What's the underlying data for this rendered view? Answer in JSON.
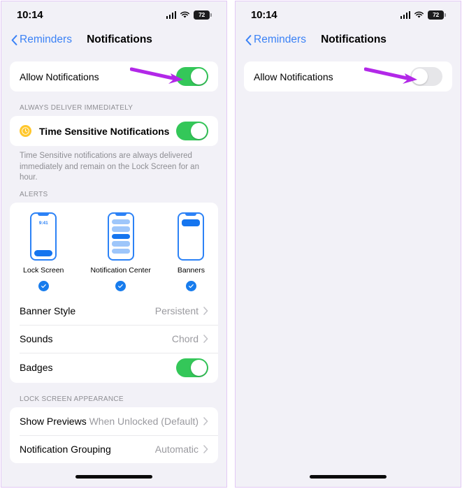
{
  "colors": {
    "accent_blue": "#3b82f6",
    "toggle_on_green": "#34c759",
    "toggle_off_gray": "#e6e6e9",
    "arrow_purple": "#b228e8",
    "alert_blue": "#1575ef",
    "check_blue": "#177ced",
    "page_bg": "#f2f1f7",
    "panel_border": "#e3c9f5",
    "time_sensitive_yellow": "#ffc72c"
  },
  "panels": [
    {
      "id": "left-panel-notifications-enabled",
      "status_bar": {
        "time": "10:14",
        "cellular_icon": "cellular-bars-icon",
        "wifi_icon": "wifi-icon",
        "battery_level": "72"
      },
      "nav": {
        "back_icon": "chevron-left-icon",
        "back_label": "Reminders",
        "title": "Notifications"
      },
      "allow_row": {
        "label": "Allow Notifications",
        "toggle_state": "on"
      },
      "annotation_arrow": {
        "icon": "arrow-right-annotation",
        "points_to": "allow-notifications-toggle"
      },
      "always_deliver": {
        "header": "ALWAYS DELIVER IMMEDIATELY",
        "row_icon": "clock-icon",
        "row_label": "Time Sensitive Notifications",
        "toggle_state": "on",
        "footnote": "Time Sensitive notifications are always delivered immediately and remain on the Lock Screen for an hour."
      },
      "alerts": {
        "header": "ALERTS",
        "options": [
          {
            "name": "Lock Screen",
            "preview_icon": "lock-screen-preview-icon",
            "preview_time": "9:41",
            "selected": true
          },
          {
            "name": "Notification Center",
            "preview_icon": "notification-center-preview-icon",
            "selected": true
          },
          {
            "name": "Banners",
            "preview_icon": "banners-preview-icon",
            "selected": true
          }
        ],
        "rows": [
          {
            "label": "Banner Style",
            "value": "Persistent",
            "type": "disclosure"
          },
          {
            "label": "Sounds",
            "value": "Chord",
            "type": "disclosure"
          },
          {
            "label": "Badges",
            "value": "",
            "type": "toggle",
            "toggle_state": "on"
          }
        ]
      },
      "lock_screen_appearance": {
        "header": "LOCK SCREEN APPEARANCE",
        "rows": [
          {
            "label": "Show Previews",
            "value": "When Unlocked (Default)"
          },
          {
            "label": "Notification Grouping",
            "value": "Automatic"
          }
        ]
      }
    },
    {
      "id": "right-panel-notifications-disabled",
      "status_bar": {
        "time": "10:14",
        "cellular_icon": "cellular-bars-icon",
        "wifi_icon": "wifi-icon",
        "battery_level": "72"
      },
      "nav": {
        "back_icon": "chevron-left-icon",
        "back_label": "Reminders",
        "title": "Notifications"
      },
      "allow_row": {
        "label": "Allow Notifications",
        "toggle_state": "off"
      },
      "annotation_arrow": {
        "icon": "arrow-right-annotation",
        "points_to": "allow-notifications-toggle"
      }
    }
  ]
}
